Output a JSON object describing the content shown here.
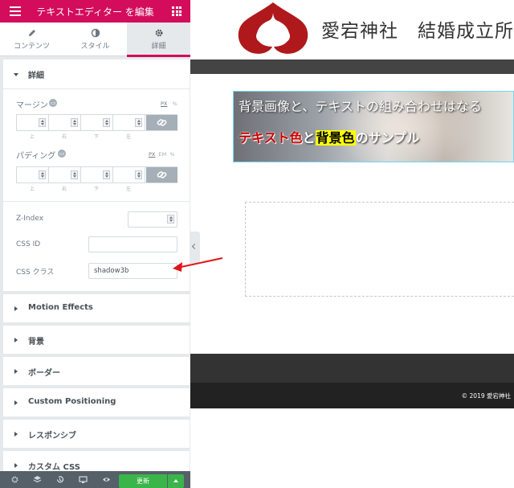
{
  "panel": {
    "header_title": "テキストエディター を編集",
    "tabs": [
      {
        "label": "コンテンツ",
        "icon": "pencil-icon"
      },
      {
        "label": "スタイル",
        "icon": "half-circle-icon"
      },
      {
        "label": "詳細",
        "icon": "gear-icon",
        "active": true
      }
    ],
    "section_advanced": "詳細",
    "margin": {
      "label": "マージン",
      "units": [
        "PX",
        "%"
      ],
      "active_unit": "PX",
      "dim_labels": [
        "上",
        "右",
        "下",
        "左"
      ]
    },
    "padding": {
      "label": "パディング",
      "units": [
        "PX",
        "EM",
        "%"
      ],
      "active_unit": "PX",
      "dim_labels": [
        "上",
        "右",
        "下",
        "左"
      ]
    },
    "z_index_label": "Z-Index",
    "css_id_label": "CSS ID",
    "css_class_label": "CSS クラス",
    "css_class_value": "shadow3b",
    "sections": [
      "Motion Effects",
      "背景",
      "ボーダー",
      "Custom Positioning",
      "レスポンシブ",
      "カスタム CSS"
    ],
    "footer": {
      "icons": [
        "gear-icon",
        "layers-icon",
        "history-icon",
        "desktop-icon",
        "eye-icon"
      ],
      "update_label": "更新"
    }
  },
  "preview": {
    "site_title": "愛宕神社　結婚成立所",
    "banner_line1": "背景画像と、テキストの組み合わせはなる",
    "banner_line2": {
      "red": "テキスト色",
      "and": "と",
      "yellow": "背景色",
      "sample": "のサンプル"
    },
    "copyright": "© 2019 愛宕神社",
    "colors": {
      "brand": "#d30c5c",
      "logo": "#b0191c",
      "update_button": "#39b54a",
      "annotation_arrow": "#e0141a"
    }
  }
}
